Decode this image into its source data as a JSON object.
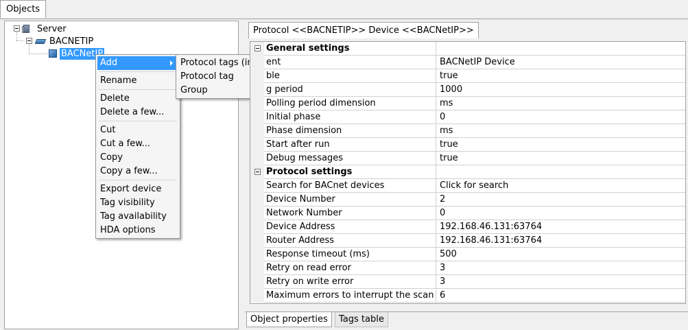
{
  "tabs": {
    "objects": "Objects"
  },
  "tree": {
    "server": "Server",
    "channel": "BACNETIP",
    "device": "BACNetIP"
  },
  "context_menu": {
    "items": [
      "Add",
      "Rename",
      "Delete",
      "Delete a few...",
      "Cut",
      "Cut a few...",
      "Copy",
      "Copy a few...",
      "Export device",
      "Tag visibility",
      "Tag availability",
      "HDA options"
    ]
  },
  "submenu": {
    "items": [
      "Protocol tags (import)",
      "Protocol tag",
      "Group"
    ]
  },
  "properties": {
    "tab_title": "Protocol <<BACNETIP>> Device <<BACNetIP>>",
    "general": {
      "title": "General settings",
      "rows": [
        {
          "name": "ent",
          "value": "BACNetIP Device"
        },
        {
          "name": "ble",
          "value": "true"
        },
        {
          "name": "g period",
          "value": "1000"
        },
        {
          "name": "Polling period dimension",
          "value": "ms"
        },
        {
          "name": "Initial phase",
          "value": "0"
        },
        {
          "name": "Phase dimension",
          "value": "ms"
        },
        {
          "name": "Start after run",
          "value": "true"
        },
        {
          "name": "Debug messages",
          "value": "true"
        }
      ]
    },
    "protocol": {
      "title": "Protocol settings",
      "rows": [
        {
          "name": "Search for BACnet devices",
          "value": "Click for search"
        },
        {
          "name": "Device Number",
          "value": "2"
        },
        {
          "name": "Network Number",
          "value": "0"
        },
        {
          "name": "Device Address",
          "value": "192.168.46.131:63764"
        },
        {
          "name": "Router Address",
          "value": "192.168.46.131:63764"
        },
        {
          "name": "Response timeout (ms)",
          "value": "500"
        },
        {
          "name": "Retry on read error",
          "value": "3"
        },
        {
          "name": "Retry on write error",
          "value": "3"
        },
        {
          "name": "Maximum errors to interrupt the scan",
          "value": "6"
        }
      ]
    }
  },
  "bottom_tabs": {
    "props": "Object properties",
    "tags": "Tags table"
  },
  "colors": {
    "selection": "#3399ff",
    "panel": "#f0f0f0"
  }
}
